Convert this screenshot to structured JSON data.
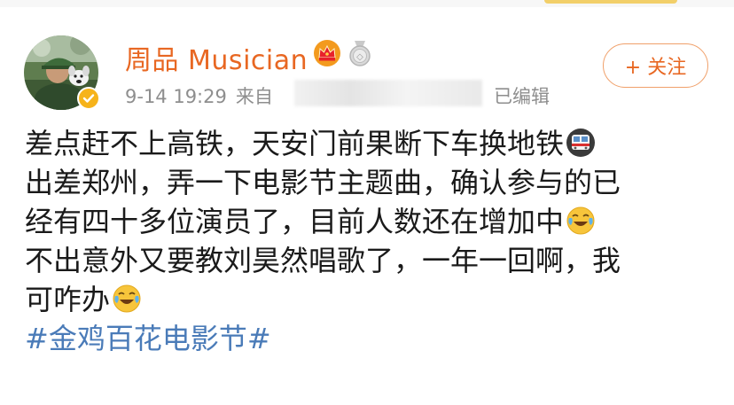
{
  "post": {
    "author": "周品 Musician",
    "timestamp": "9-14 19:29",
    "source_prefix": "来自",
    "edited_label": "已编辑",
    "follow_label": "+ 关注",
    "lines": [
      "差点赶不上高铁，天安门前果断下车换地铁",
      "出差郑州，弄一下电影节主题曲，确认参与的已",
      "经有四十多位演员了，目前人数还在增加中",
      "不出意外又要教刘昊然唱歌了，一年一回啊，我",
      "可咋办"
    ],
    "hashtag": "#金鸡百花电影节#"
  },
  "icons": {
    "verified": "verified-badge-icon",
    "crown": "crown-icon",
    "medal": "medal-icon",
    "subway": "subway-train-emoji",
    "laugh_cry": "laugh-cry-emoji"
  },
  "colors": {
    "username": "#e86722",
    "meta": "#8e8e8e",
    "hashtag": "#4a7bb8",
    "badge": "#f6b31a"
  }
}
